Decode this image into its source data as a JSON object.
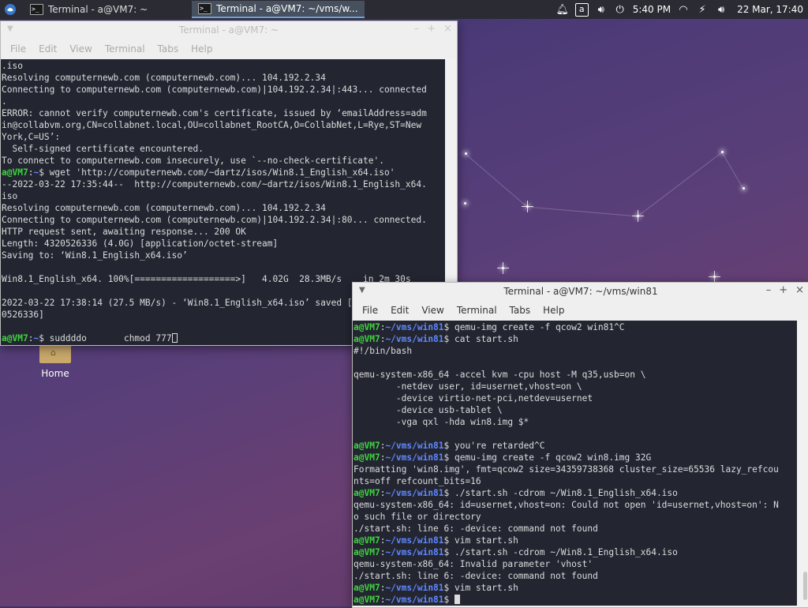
{
  "panel": {
    "tasks": [
      {
        "label": "Terminal - a@VM7: ~"
      },
      {
        "label": "Terminal - a@VM7: ~/vms/w..."
      }
    ],
    "tray": {
      "notify_icon": "bell-icon",
      "a_label": "a",
      "volume_icon": "speaker-icon",
      "power_icon": "power-icon",
      "time": "5:40 PM",
      "network_icon": "wifi-icon",
      "battery_icon": "battery-bolt-icon",
      "volume2_icon": "speaker-icon",
      "datetime": "22 Mar, 17:40"
    }
  },
  "desktop": {
    "home_label": "Home"
  },
  "window1": {
    "title": "Terminal - a@VM7: ~",
    "menu": [
      "File",
      "Edit",
      "View",
      "Terminal",
      "Tabs",
      "Help"
    ],
    "lines": [
      {
        "text": ".iso"
      },
      {
        "text": "Resolving computernewb.com (computernewb.com)... 104.192.2.34"
      },
      {
        "text": "Connecting to computernewb.com (computernewb.com)|104.192.2.34|:443... connected"
      },
      {
        "text": "."
      },
      {
        "text": "ERROR: cannot verify computernewb.com's certificate, issued by ‘emailAddress=adm"
      },
      {
        "text": "in@collabvm.org,CN=collabnet.local,OU=collabnet_RootCA,O=CollabNet,L=Rye,ST=New"
      },
      {
        "text": "York,C=US’:"
      },
      {
        "text": "  Self-signed certificate encountered."
      },
      {
        "text": "To connect to computernewb.com insecurely, use `--no-check-certificate'."
      },
      {
        "user": "a@VM7",
        "path": "~",
        "cmd": "$ wget 'http://computernewb.com/~dartz/isos/Win8.1_English_x64.iso'"
      },
      {
        "text": "--2022-03-22 17:35:44--  http://computernewb.com/~dartz/isos/Win8.1_English_x64."
      },
      {
        "text": "iso"
      },
      {
        "text": "Resolving computernewb.com (computernewb.com)... 104.192.2.34"
      },
      {
        "text": "Connecting to computernewb.com (computernewb.com)|104.192.2.34|:80... connected."
      },
      {
        "text": "HTTP request sent, awaiting response... 200 OK"
      },
      {
        "text": "Length: 4320526336 (4.0G) [application/octet-stream]"
      },
      {
        "text": "Saving to: ‘Win8.1_English_x64.iso’"
      },
      {
        "text": ""
      },
      {
        "text": "Win8.1_English_x64. 100%[===================>]   4.02G  28.3MB/s    in 2m 30s"
      },
      {
        "text": ""
      },
      {
        "text": "2022-03-22 17:38:14 (27.5 MB/s) - ‘Win8.1_English_x64.iso’ saved [4320526336/432"
      },
      {
        "text": "0526336]"
      },
      {
        "text": ""
      },
      {
        "user": "a@VM7",
        "path": "~",
        "cmd": "$ suddddo       chmod 777",
        "cursor": "hollow"
      }
    ]
  },
  "window2": {
    "title": "Terminal - a@VM7: ~/vms/win81",
    "menu": [
      "File",
      "Edit",
      "View",
      "Terminal",
      "Tabs",
      "Help"
    ],
    "lines": [
      {
        "user": "a@VM7",
        "path": "~/vms/win81",
        "cmd": "$ qemu-img create -f qcow2 win81^C"
      },
      {
        "user": "a@VM7",
        "path": "~/vms/win81",
        "cmd": "$ cat start.sh"
      },
      {
        "text": "#!/bin/bash"
      },
      {
        "text": ""
      },
      {
        "text": "qemu-system-x86_64 -accel kvm -cpu host -M q35,usb=on \\"
      },
      {
        "text": "        -netdev user, id=usernet,vhost=on \\"
      },
      {
        "text": "        -device virtio-net-pci,netdev=usernet"
      },
      {
        "text": "        -device usb-tablet \\"
      },
      {
        "text": "        -vga qxl -hda win8.img $*"
      },
      {
        "text": ""
      },
      {
        "user": "a@VM7",
        "path": "~/vms/win81",
        "cmd": "$ you're retarded^C"
      },
      {
        "user": "a@VM7",
        "path": "~/vms/win81",
        "cmd": "$ qemu-img create -f qcow2 win8.img 32G"
      },
      {
        "text": "Formatting 'win8.img', fmt=qcow2 size=34359738368 cluster_size=65536 lazy_refcou"
      },
      {
        "text": "nts=off refcount_bits=16"
      },
      {
        "user": "a@VM7",
        "path": "~/vms/win81",
        "cmd": "$ ./start.sh -cdrom ~/Win8.1_English_x64.iso"
      },
      {
        "text": "qemu-system-x86_64: id=usernet,vhost=on: Could not open 'id=usernet,vhost=on': N"
      },
      {
        "text": "o such file or directory"
      },
      {
        "text": "./start.sh: line 6: -device: command not found"
      },
      {
        "user": "a@VM7",
        "path": "~/vms/win81",
        "cmd": "$ vim start.sh"
      },
      {
        "user": "a@VM7",
        "path": "~/vms/win81",
        "cmd": "$ ./start.sh -cdrom ~/Win8.1_English_x64.iso"
      },
      {
        "text": "qemu-system-x86_64: Invalid parameter 'vhost'"
      },
      {
        "text": "./start.sh: line 6: -device: command not found"
      },
      {
        "user": "a@VM7",
        "path": "~/vms/win81",
        "cmd": "$ vim start.sh"
      },
      {
        "user": "a@VM7",
        "path": "~/vms/win81",
        "cmd": "$ ",
        "cursor": "solid"
      }
    ]
  }
}
